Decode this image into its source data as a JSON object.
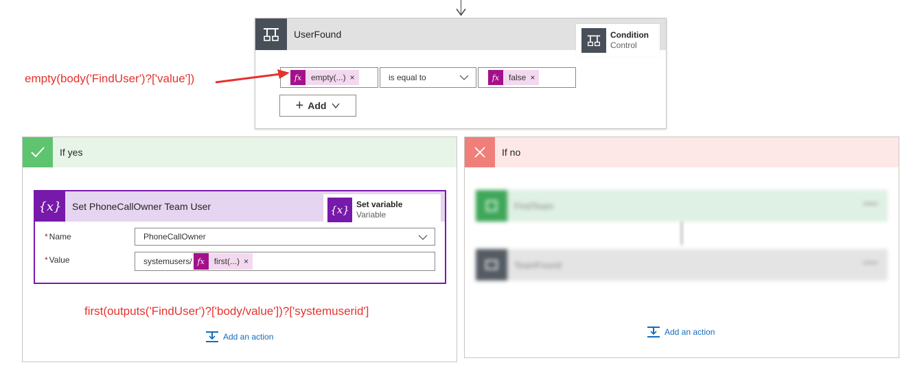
{
  "condition": {
    "title": "UserFound",
    "tooltip": {
      "title": "Condition",
      "subtitle": "Control"
    },
    "left_operand": {
      "token": "empty(...)",
      "remove": "×"
    },
    "operator": "is equal to",
    "right_operand": {
      "token": "false",
      "remove": "×"
    },
    "add_button": {
      "plus": "+",
      "label": "Add"
    }
  },
  "annotations": {
    "condition_expression": "empty(body('FindUser')?['value'])",
    "value_expression": "first(outputs('FindUser')?['body/value'])?['systemuserid']"
  },
  "yes_branch": {
    "label": "If yes",
    "set_variable": {
      "title": "Set PhoneCallOwner Team User",
      "tooltip": {
        "title": "Set variable",
        "subtitle": "Variable"
      },
      "icon_text": "{x}",
      "name_label": "Name",
      "name_value": "PhoneCallOwner",
      "value_label": "Value",
      "value_prefix": "systemusers/",
      "value_token": "first(...)",
      "value_remove": "×",
      "required_mark": "*"
    },
    "add_action": "Add an action"
  },
  "no_branch": {
    "label": "If no",
    "blurred_steps": [
      "FindTeam",
      "TeamFound"
    ],
    "add_action": "Add an action"
  },
  "colors": {
    "yes_green": "#5fc46f",
    "no_red": "#f07f7a",
    "variable_purple": "#7719aa",
    "expression_magenta": "#a4108c",
    "annotation_red": "#e5322d",
    "control_gray": "#484f58"
  }
}
